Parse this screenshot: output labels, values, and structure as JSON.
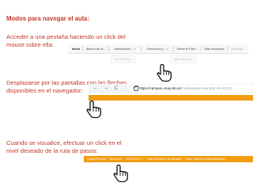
{
  "page": {
    "title": "Modos para navegar el aula:",
    "step1": "Acceder a una pestaña haciendo un click del mouse sobre ella:",
    "step2": "Desplazarse por las pantallas con las flechas disponibles en el navegador:",
    "step3": "Cuando se visualice, efectuar un click en el nivel deseado de la ruta de pasos:"
  },
  "tabs": {
    "items": [
      {
        "label": "Inicio"
      },
      {
        "label": "Acerca de la..."
      },
      {
        "label": "Introducción..."
      },
      {
        "label": "Funciones y..."
      },
      {
        "label": "Sobre el Prim..."
      },
      {
        "label": "Más funciones"
      },
      {
        "label": "Práctica"
      }
    ],
    "sub_items": [
      {
        "label": "Sobre el Seg..."
      },
      {
        "label": "Más sobre Sc..."
      }
    ]
  },
  "browser": {
    "back": "←",
    "forward": "→",
    "reload": "C",
    "url_host": "https://campus.unaj.edu.ar",
    "url_path": "/mod/assign/view.php?id=22712"
  },
  "breadcrumb": {
    "items": [
      {
        "label": "Página Principal"
      },
      {
        "label": "Mis cursos"
      },
      {
        "label": "SEC/2021/1° C"
      },
      {
        "label": "Más funciones y las variables"
      },
      {
        "label": "Tarea: realizá la propia simulación"
      }
    ],
    "separator": "/"
  },
  "colors": {
    "accent": "#f39c12",
    "title_text": "#c0392b"
  },
  "icons": [
    "hand-pointer-icon",
    "lock-icon"
  ]
}
